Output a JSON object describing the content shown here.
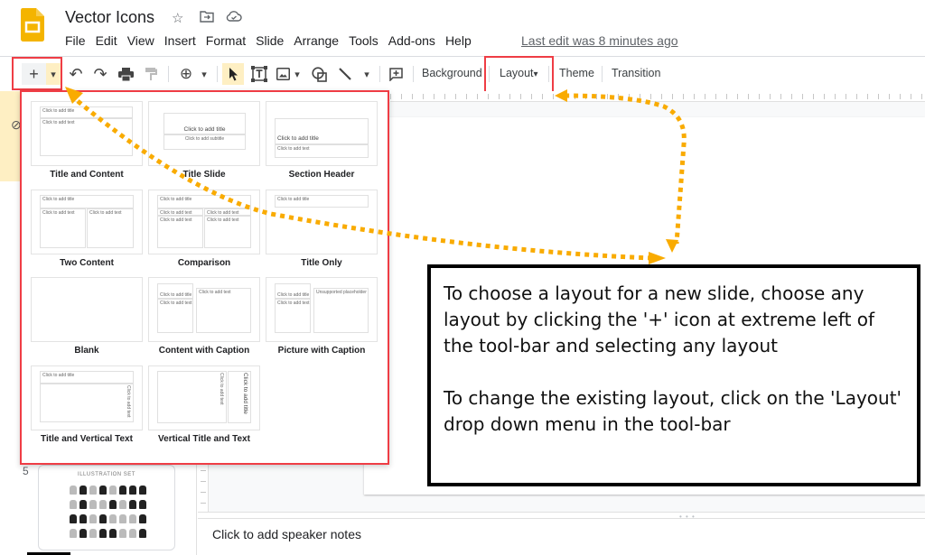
{
  "app": {
    "doc_title": "Vector Icons",
    "title_icons": [
      "star-icon",
      "move-to-folder-icon",
      "cloud-saved-icon"
    ],
    "last_edit": "Last edit was 8 minutes ago",
    "menu": [
      "File",
      "Edit",
      "View",
      "Insert",
      "Format",
      "Slide",
      "Arrange",
      "Tools",
      "Add-ons",
      "Help"
    ]
  },
  "toolbar": {
    "new_slide_icon": "+",
    "new_slide_dropdown_icon": "▾",
    "undo_icon": "↶",
    "redo_icon": "↷",
    "print_icon": "🖶",
    "paint_format_icon": "⍑",
    "zoom_icon": "⊕",
    "zoom_dropdown_icon": "▾",
    "select_icon": "➤",
    "textbox_icon": "T",
    "image_icon": "▣",
    "image_dropdown_icon": "▾",
    "shape_icon": "◯",
    "line_icon": "╲",
    "line_dropdown_icon": "▾",
    "comment_icon": "⊞",
    "background_label": "Background",
    "layout_label": "Layout",
    "layout_caret": "▾",
    "theme_label": "Theme",
    "transition_label": "Transition"
  },
  "layout_panel": {
    "items": [
      {
        "name": "Title and Content",
        "placeholders": [
          "Click to add title",
          "Click to add text"
        ]
      },
      {
        "name": "Title Slide",
        "placeholders": [
          "Click to add title",
          "Click to add subtitle"
        ]
      },
      {
        "name": "Section Header",
        "placeholders": [
          "Click to add title",
          "Click to add text"
        ]
      },
      {
        "name": "Two Content",
        "placeholders": [
          "Click to add title",
          "Click to add text",
          "Click to add text"
        ]
      },
      {
        "name": "Comparison",
        "placeholders": [
          "Click to add title",
          "Click to add text",
          "Click to add text",
          "Click to add text",
          "Click to add text"
        ]
      },
      {
        "name": "Title Only",
        "placeholders": [
          "Click to add title"
        ]
      },
      {
        "name": "Blank",
        "placeholders": []
      },
      {
        "name": "Content with Caption",
        "placeholders": [
          "Click to add title",
          "Click to add text",
          "Click to add text"
        ]
      },
      {
        "name": "Picture with Caption",
        "placeholders": [
          "Click to add title",
          "Click to add text",
          "Unsupported placeholder"
        ]
      },
      {
        "name": "Title and Vertical Text",
        "placeholders": [
          "Click to add title",
          "Click to add text"
        ]
      },
      {
        "name": "Vertical Title and Text",
        "placeholders": [
          "Click to add text",
          "Click to add title"
        ]
      }
    ]
  },
  "filmstrip": {
    "slide_number": "5",
    "thumb_title": "ILLUSTRATION SET"
  },
  "notes": {
    "placeholder": "Click to add speaker notes",
    "resize_handle": "• • •"
  },
  "callout": {
    "paragraph_1": "To choose a layout for a new slide, choose any layout by clicking the '+' icon at extreme left of the tool-bar and selecting any layout",
    "paragraph_2": "To change the existing layout, click on the 'Layout' drop down menu in the tool-bar"
  },
  "colors": {
    "annotation_red": "#ef3d45",
    "arrow_orange": "#f9ab00",
    "highlight_yellow": "#feefc3",
    "slides_logo": "#f4b400"
  }
}
